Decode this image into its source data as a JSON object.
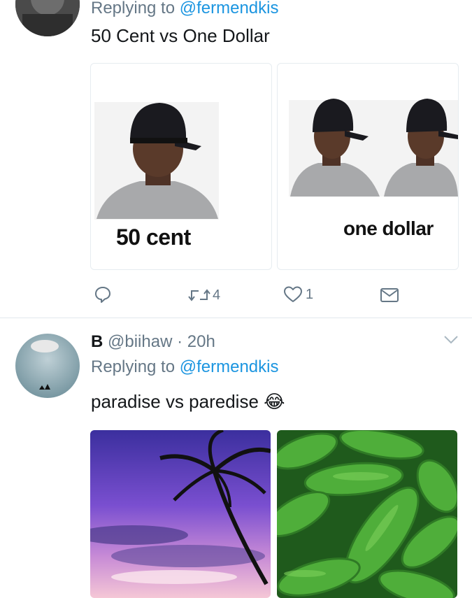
{
  "tweet1": {
    "replying_prefix": "Replying to",
    "replying_handle": "@fermendkis",
    "text": "50 Cent vs One Dollar",
    "media": [
      {
        "caption": "50 cent"
      },
      {
        "caption": "one dollar"
      }
    ],
    "actions": {
      "reply_icon": "reply-icon",
      "retweet_icon": "retweet-icon",
      "retweet_count": "4",
      "like_icon": "heart-icon",
      "like_count": "1",
      "dm_icon": "envelope-icon"
    }
  },
  "tweet2": {
    "name": "B",
    "handle": "@biihaw",
    "separator": "·",
    "time": "20h",
    "replying_prefix": "Replying to",
    "replying_handle": "@fermendkis",
    "text": "paradise vs paredise",
    "emoji": "😂",
    "caret_icon": "chevron-down-icon"
  },
  "colors": {
    "link": "#1b95e0",
    "secondary": "#657786",
    "divider": "#e1e8ed",
    "cap": "#1a1a1f",
    "shirt": "#a8a9ab",
    "skin": "#5a3a2a",
    "sunset_purple": "#7a4fd0",
    "melon_green": "#4fae3a"
  }
}
